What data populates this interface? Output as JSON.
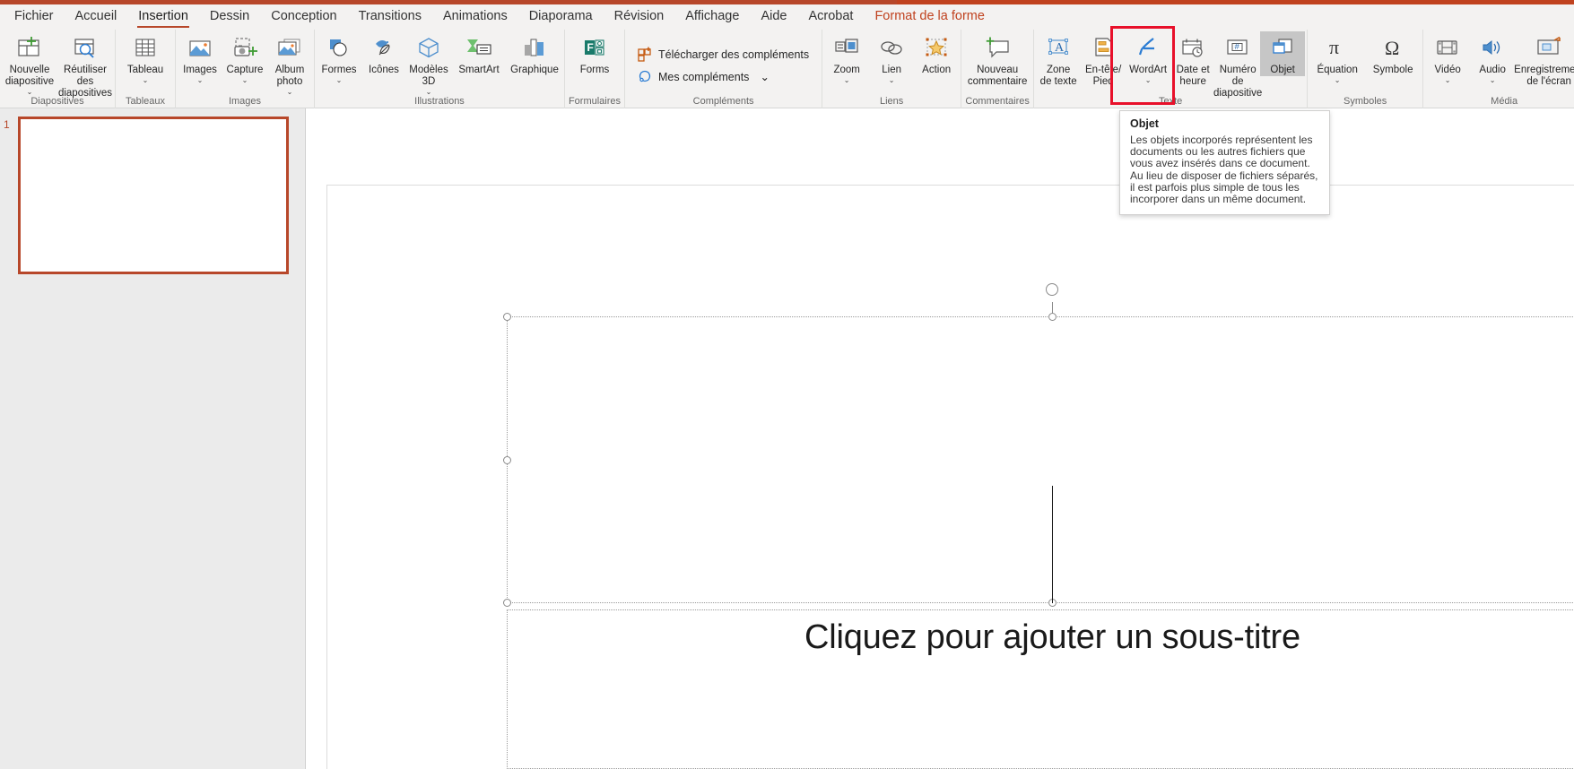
{
  "window": {
    "accent_color": "#b7472a",
    "contextual_tab_color": "#c0421f"
  },
  "tabs": [
    {
      "label": "Fichier",
      "active": false,
      "contextual": false
    },
    {
      "label": "Accueil",
      "active": false,
      "contextual": false
    },
    {
      "label": "Insertion",
      "active": true,
      "contextual": false
    },
    {
      "label": "Dessin",
      "active": false,
      "contextual": false
    },
    {
      "label": "Conception",
      "active": false,
      "contextual": false
    },
    {
      "label": "Transitions",
      "active": false,
      "contextual": false
    },
    {
      "label": "Animations",
      "active": false,
      "contextual": false
    },
    {
      "label": "Diaporama",
      "active": false,
      "contextual": false
    },
    {
      "label": "Révision",
      "active": false,
      "contextual": false
    },
    {
      "label": "Affichage",
      "active": false,
      "contextual": false
    },
    {
      "label": "Aide",
      "active": false,
      "contextual": false
    },
    {
      "label": "Acrobat",
      "active": false,
      "contextual": false
    },
    {
      "label": "Format de la forme",
      "active": false,
      "contextual": true
    }
  ],
  "ribbon": {
    "groups": [
      {
        "name": "Diapositives",
        "label": "Diapositives",
        "buttons": [
          {
            "label": "Nouvelle\ndiapositive",
            "icon": "new-slide-icon",
            "caret": true
          },
          {
            "label": "Réutiliser des\ndiapositives",
            "icon": "reuse-slides-icon",
            "caret": false
          }
        ]
      },
      {
        "name": "Tableaux",
        "label": "Tableaux",
        "buttons": [
          {
            "label": "Tableau",
            "icon": "table-icon",
            "caret": true
          }
        ]
      },
      {
        "name": "Images",
        "label": "Images",
        "buttons": [
          {
            "label": "Images",
            "icon": "pictures-icon",
            "caret": true
          },
          {
            "label": "Capture",
            "icon": "screenshot-icon",
            "caret": true
          },
          {
            "label": "Album\nphoto",
            "icon": "photo-album-icon",
            "caret": true
          }
        ]
      },
      {
        "name": "Illustrations",
        "label": "Illustrations",
        "buttons": [
          {
            "label": "Formes",
            "icon": "shapes-icon",
            "caret": true
          },
          {
            "label": "Icônes",
            "icon": "icons-icon",
            "caret": false
          },
          {
            "label": "Modèles\n3D",
            "icon": "models3d-icon",
            "caret": true
          },
          {
            "label": "SmartArt",
            "icon": "smartart-icon",
            "caret": false
          },
          {
            "label": "Graphique",
            "icon": "chart-icon",
            "caret": false
          }
        ]
      },
      {
        "name": "Formulaires",
        "label": "Formulaires",
        "buttons": [
          {
            "label": "Forms",
            "icon": "forms-icon",
            "caret": false
          }
        ]
      },
      {
        "name": "Compléments",
        "label": "Compléments",
        "buttons": [
          {
            "label": "Télécharger des compléments",
            "icon": "get-addins-icon",
            "caret": false
          },
          {
            "label": "Mes compléments",
            "icon": "my-addins-icon",
            "caret": true
          }
        ]
      },
      {
        "name": "Liens",
        "label": "Liens",
        "buttons": [
          {
            "label": "Zoom",
            "icon": "zoom-icon",
            "caret": true
          },
          {
            "label": "Lien",
            "icon": "link-icon",
            "caret": true
          },
          {
            "label": "Action",
            "icon": "action-icon",
            "caret": false
          }
        ]
      },
      {
        "name": "Commentaires",
        "label": "Commentaires",
        "buttons": [
          {
            "label": "Nouveau\ncommentaire",
            "icon": "new-comment-icon",
            "caret": false
          }
        ]
      },
      {
        "name": "Texte",
        "label": "Texte",
        "buttons": [
          {
            "label": "Zone\nde texte",
            "icon": "text-box-icon",
            "caret": false
          },
          {
            "label": "En-tête/\nPied",
            "icon": "header-footer-icon",
            "caret": false
          },
          {
            "label": "WordArt",
            "icon": "wordart-icon",
            "caret": true
          },
          {
            "label": "Date et\nheure",
            "icon": "date-time-icon",
            "caret": false
          },
          {
            "label": "Numéro de\ndiapositive",
            "icon": "slide-number-icon",
            "caret": false
          },
          {
            "label": "Objet",
            "icon": "object-icon",
            "caret": false,
            "hovered": true,
            "highlighted": true
          }
        ]
      },
      {
        "name": "Symboles",
        "label": "Symboles",
        "buttons": [
          {
            "label": "Équation",
            "icon": "equation-icon",
            "caret": true
          },
          {
            "label": "Symbole",
            "icon": "symbol-icon",
            "caret": false
          }
        ]
      },
      {
        "name": "Média",
        "label": "Média",
        "buttons": [
          {
            "label": "Vidéo",
            "icon": "video-icon",
            "caret": true
          },
          {
            "label": "Audio",
            "icon": "audio-icon",
            "caret": true
          },
          {
            "label": "Enregistrement\nde l'écran",
            "icon": "screen-recording-icon",
            "caret": false
          }
        ]
      }
    ]
  },
  "tooltip": {
    "title": "Objet",
    "body": "Les objets incorporés représentent les documents ou les autres fichiers que vous avez insérés dans ce document. Au lieu de disposer de fichiers séparés, il est parfois plus simple de tous les incorporer dans un même document."
  },
  "slide_panel": {
    "slides": [
      {
        "number": "1",
        "selected": true
      }
    ]
  },
  "canvas": {
    "title_placeholder_text": "",
    "subtitle_placeholder_text": "Cliquez pour ajouter un sous-titre"
  }
}
